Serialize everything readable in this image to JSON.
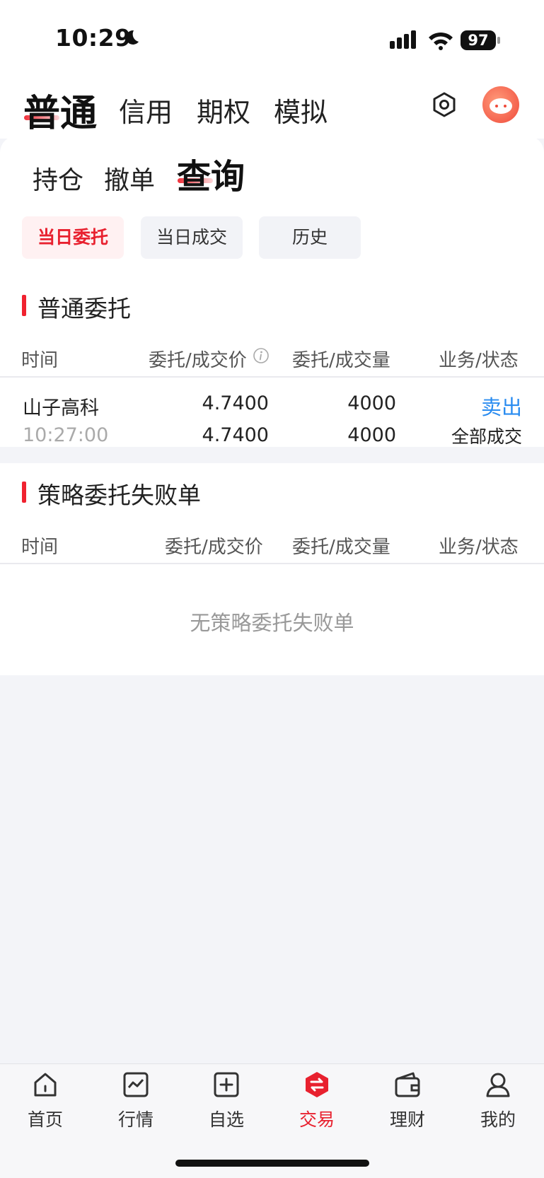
{
  "status_bar": {
    "time": "10:29",
    "battery": "97"
  },
  "top_tabs": [
    "普通",
    "信用",
    "期权",
    "模拟"
  ],
  "sub_tabs": [
    "持仓",
    "撤单",
    "查询"
  ],
  "filter_chips": [
    "当日委托",
    "当日成交",
    "历史"
  ],
  "section_orders": {
    "title": "普通委托",
    "columns": [
      "时间",
      "委托/成交价",
      "委托/成交量",
      "业务/状态"
    ],
    "row": {
      "name": "山子高科",
      "time": "10:27:00",
      "order_price": "4.7400",
      "deal_price": "4.7400",
      "order_qty": "4000",
      "deal_qty": "4000",
      "business": "卖出",
      "status": "全部成交"
    }
  },
  "section_strategy": {
    "title": "策略委托失败单",
    "columns": [
      "时间",
      "委托/成交价",
      "委托/成交量",
      "业务/状态"
    ],
    "empty_text": "无策略委托失败单"
  },
  "bottom_nav": [
    "首页",
    "行情",
    "自选",
    "交易",
    "理财",
    "我的"
  ],
  "colors": {
    "accent": "#e8212f",
    "link": "#2a8cf0"
  }
}
